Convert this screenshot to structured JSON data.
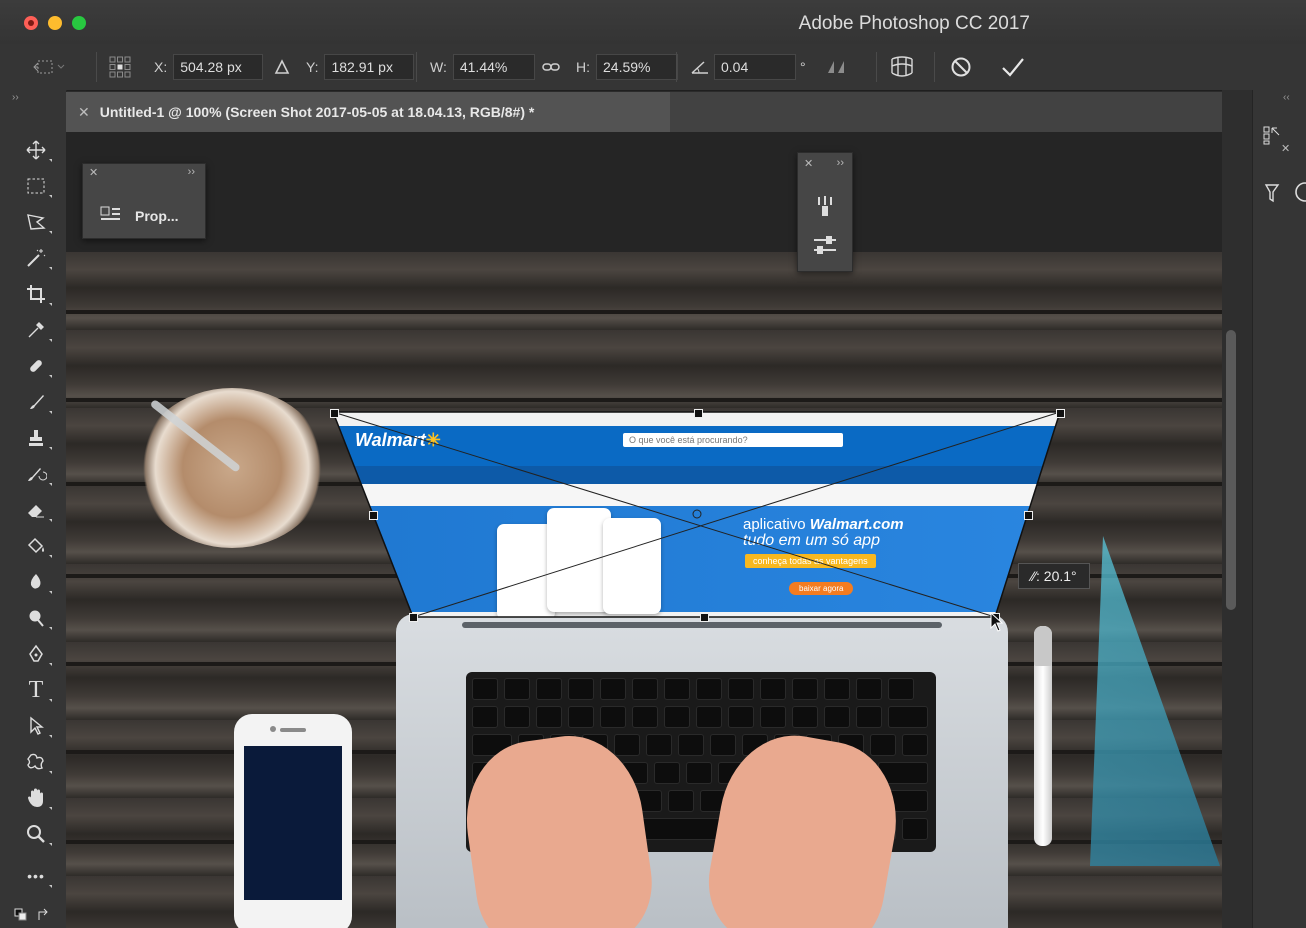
{
  "window": {
    "title": "Adobe Photoshop CC 2017"
  },
  "options": {
    "x_label": "X:",
    "x_value": "504.28 px",
    "y_label": "Y:",
    "y_value": "182.91 px",
    "w_label": "W:",
    "w_value": "41.44%",
    "h_label": "H:",
    "h_value": "24.59%",
    "angle_value": "0.04",
    "angle_unit": "°"
  },
  "document_tab": {
    "label": "Untitled-1 @ 100% (Screen Shot 2017-05-05 at 18.04.13, RGB/8#) *"
  },
  "properties_panel": {
    "label": "Prop..."
  },
  "transform_tooltip": {
    "label": ": 20.1°"
  },
  "website": {
    "logo": "Walmart",
    "search_placeholder": "O que você está procurando?",
    "headline_prefix": "aplicativo ",
    "headline_brand": "Walmart.com",
    "subheadline": "tudo em um só app",
    "cta_primary": "conheça todas as vantagens",
    "cta_secondary": "baixar agora"
  },
  "colors": {
    "walmart_blue": "#0a6ac4",
    "walmart_yellow": "#ffc220",
    "ps_panel": "#353535"
  }
}
